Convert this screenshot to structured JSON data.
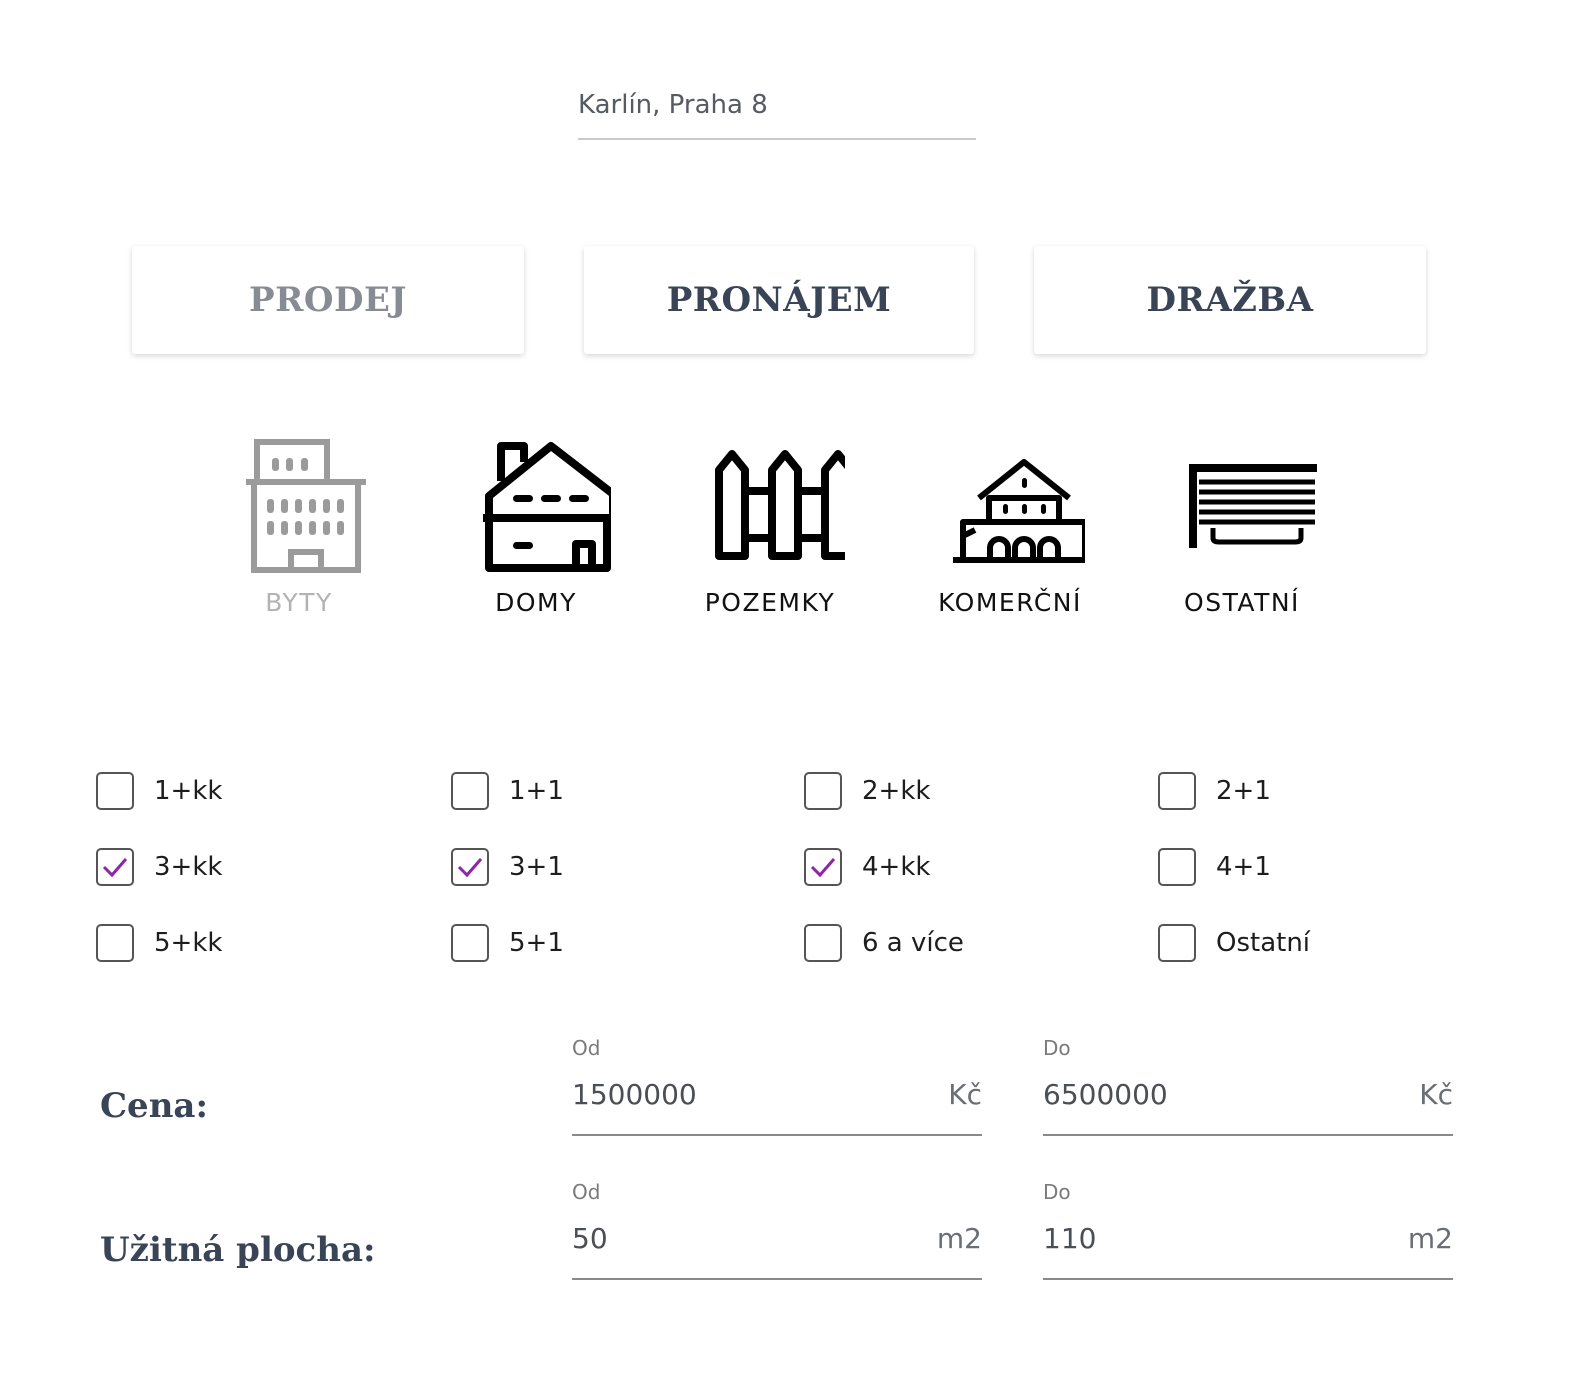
{
  "location": {
    "value": "Karlín, Praha 8"
  },
  "tabs": [
    {
      "label": "PRODEJ",
      "active": false
    },
    {
      "label": "PRONÁJEM",
      "active": true
    },
    {
      "label": "DRAŽBA",
      "active": true
    }
  ],
  "property_types": [
    {
      "label": "BYTY",
      "icon": "apartment-building-icon",
      "active": false
    },
    {
      "label": "DOMY",
      "icon": "house-icon",
      "active": true
    },
    {
      "label": "POZEMKY",
      "icon": "fence-icon",
      "active": true
    },
    {
      "label": "KOMERČNÍ",
      "icon": "commercial-building-icon",
      "active": true
    },
    {
      "label": "OSTATNÍ",
      "icon": "garage-icon",
      "active": true
    }
  ],
  "layouts": [
    {
      "label": "1+kk",
      "checked": false
    },
    {
      "label": "1+1",
      "checked": false
    },
    {
      "label": "2+kk",
      "checked": false
    },
    {
      "label": "2+1",
      "checked": false
    },
    {
      "label": "3+kk",
      "checked": true
    },
    {
      "label": "3+1",
      "checked": true
    },
    {
      "label": "4+kk",
      "checked": true
    },
    {
      "label": "4+1",
      "checked": false
    },
    {
      "label": "5+kk",
      "checked": false
    },
    {
      "label": "5+1",
      "checked": false
    },
    {
      "label": "6 a více",
      "checked": false
    },
    {
      "label": "Ostatní",
      "checked": false
    }
  ],
  "price": {
    "label": "Cena:",
    "from": {
      "caption": "Od",
      "value": "1500000",
      "unit": "Kč"
    },
    "to": {
      "caption": "Do",
      "value": "6500000",
      "unit": "Kč"
    }
  },
  "area": {
    "label": "Užitná plocha:",
    "from": {
      "caption": "Od",
      "value": "50",
      "unit": "m2"
    },
    "to": {
      "caption": "Do",
      "value": "110",
      "unit": "m2"
    }
  },
  "colors": {
    "accent": "#8e24aa",
    "heading": "#3a4457",
    "inactive": "#878c94"
  }
}
